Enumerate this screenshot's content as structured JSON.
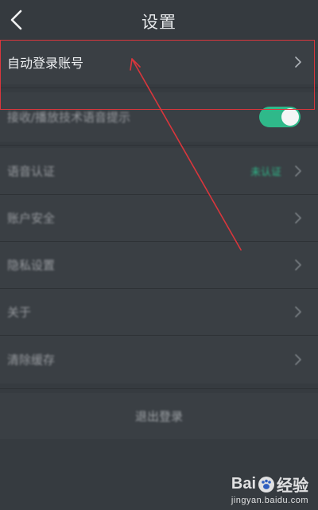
{
  "header": {
    "title": "设置",
    "back_icon": "chevron-left-icon"
  },
  "rows": {
    "auto_login": {
      "label": "自动登录账号"
    },
    "toggle_item": {
      "label": "接收/播放技术语音提示",
      "toggle_on": true
    },
    "item_3": {
      "label": "语音认证",
      "status": "未认证"
    },
    "item_4": {
      "label": "账户安全"
    },
    "item_5": {
      "label": "隐私设置"
    },
    "item_6": {
      "label": "关于"
    },
    "item_7": {
      "label": "清除缓存"
    }
  },
  "logout": {
    "label": "退出登录"
  },
  "watermark": {
    "brand_left": "Bai",
    "brand_right": "经验",
    "domain": "jingyan.baidu.com"
  },
  "colors": {
    "background": "#363b40",
    "row": "#3a3f44",
    "accent": "#2fb98a",
    "annotation": "#d9363c"
  }
}
